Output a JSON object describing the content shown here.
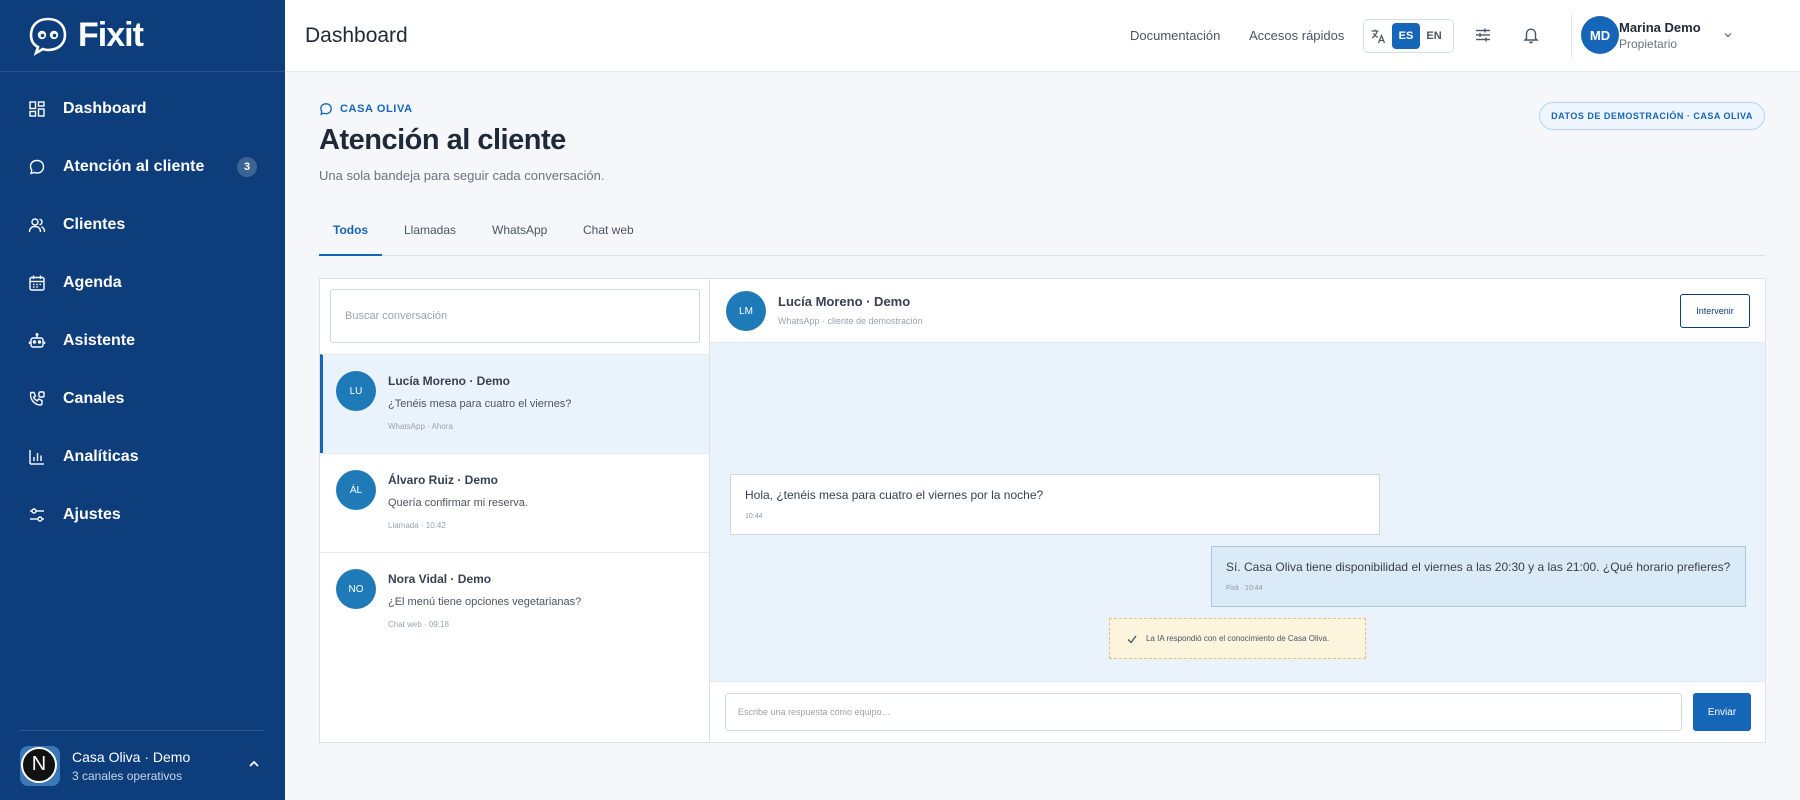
{
  "brand": {
    "name": "Fixit",
    "icon": "fixit-logo-icon"
  },
  "colors": {
    "sidebar": "#0d3d7a",
    "accent": "#1565b8",
    "active_bg": "#eaf3fc"
  },
  "sidebar": {
    "items": [
      {
        "label": "Dashboard",
        "icon": "dashboard-icon"
      },
      {
        "label": "Atención al cliente",
        "icon": "chat-icon",
        "badge": "3"
      },
      {
        "label": "Clientes",
        "icon": "users-icon"
      },
      {
        "label": "Agenda",
        "icon": "calendar-icon"
      },
      {
        "label": "Asistente",
        "icon": "robot-icon"
      },
      {
        "label": "Canales",
        "icon": "channels-icon"
      },
      {
        "label": "Analíticas",
        "icon": "chart-icon"
      },
      {
        "label": "Ajustes",
        "icon": "settings-icon"
      }
    ],
    "footer": {
      "initial": "N",
      "name": "Casa Oliva · Demo",
      "subtitle": "3 canales operativos"
    }
  },
  "topbar": {
    "title": "Dashboard",
    "links": [
      "Documentación",
      "Accesos rápidos"
    ],
    "languages": [
      "ES",
      "EN"
    ],
    "active_language": "ES",
    "user": {
      "initials": "MD",
      "name": "Marina Demo",
      "role": "Propietario"
    }
  },
  "main": {
    "breadcrumb": "CASA OLIVA",
    "demo_badge": "DATOS DE DEMOSTRACIÓN · CASA OLIVA",
    "title": "Atención al cliente",
    "subtitle": "Una sola bandeja para seguir cada conversación.",
    "tabs": [
      "Todos",
      "Llamadas",
      "WhatsApp",
      "Chat web"
    ],
    "active_tab": "Todos"
  },
  "inbox": {
    "search_placeholder": "Buscar conversación",
    "conversations": [
      {
        "initials": "LU",
        "name": "Lucía Moreno · Demo",
        "preview": "¿Tenéis mesa para cuatro el viernes?",
        "meta": "WhatsApp · Ahora",
        "active": true
      },
      {
        "initials": "ÁL",
        "name": "Álvaro Ruiz · Demo",
        "preview": "Quería confirmar mi reserva.",
        "meta": "Llamada · 10:42"
      },
      {
        "initials": "NO",
        "name": "Nora Vidal · Demo",
        "preview": "¿El menú tiene opciones vegetarianas?",
        "meta": "Chat web · 09:18"
      }
    ]
  },
  "thread": {
    "initials": "LM",
    "name": "Lucía Moreno · Demo",
    "subtitle": "WhatsApp · cliente de demostración",
    "intervene_label": "Intervenir",
    "messages": [
      {
        "text": "Hola, ¿tenéis mesa para cuatro el viernes por la noche?",
        "meta": "10:44"
      },
      {
        "text": "Sí. Casa Oliva tiene disponibilidad el viernes a las 20:30 y a las 21:00. ¿Qué horario prefieres?",
        "meta": "Fixit · 10:44"
      }
    ],
    "ai_note": "La IA respondió con el conocimiento de Casa Oliva.",
    "reply_placeholder": "Escribe una respuesta como equipo…",
    "send_label": "Enviar"
  }
}
